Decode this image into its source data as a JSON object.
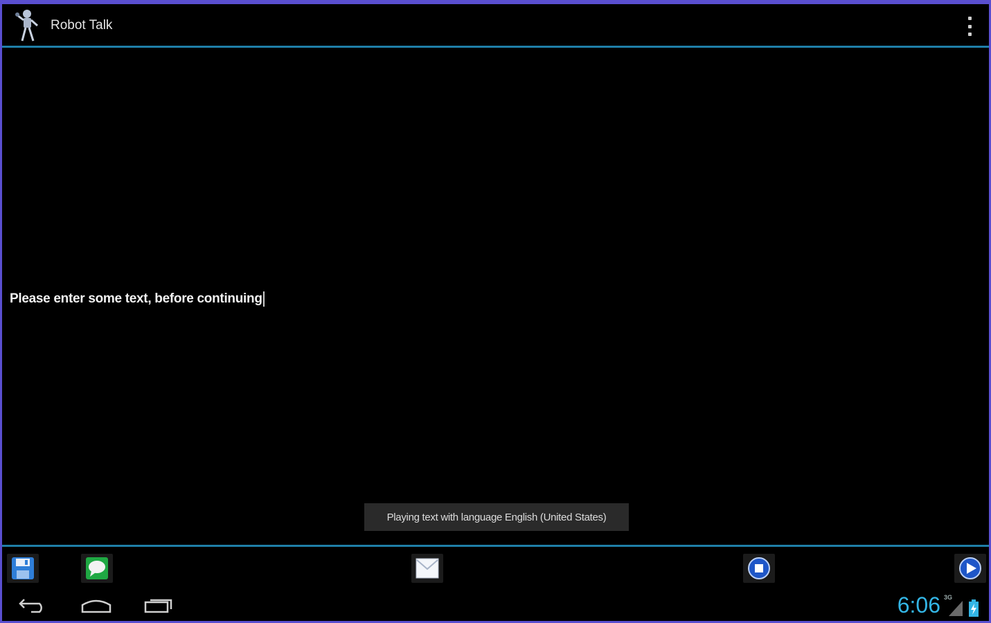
{
  "app": {
    "title": "Robot Talk"
  },
  "editor": {
    "text": "Please enter some text, before continuing"
  },
  "toast": {
    "message": "Playing text with language English (United States)"
  },
  "toolbar": {
    "buttons": [
      {
        "icon": "save-icon"
      },
      {
        "icon": "speech-bubble-icon"
      },
      {
        "icon": "mail-icon"
      },
      {
        "icon": "stop-icon"
      },
      {
        "icon": "play-icon"
      }
    ]
  },
  "status": {
    "time": "6:06",
    "network": "3G"
  },
  "colors": {
    "accent": "#33b5e5",
    "divider": "#1f7fa8",
    "frame": "#5a4fd0"
  }
}
